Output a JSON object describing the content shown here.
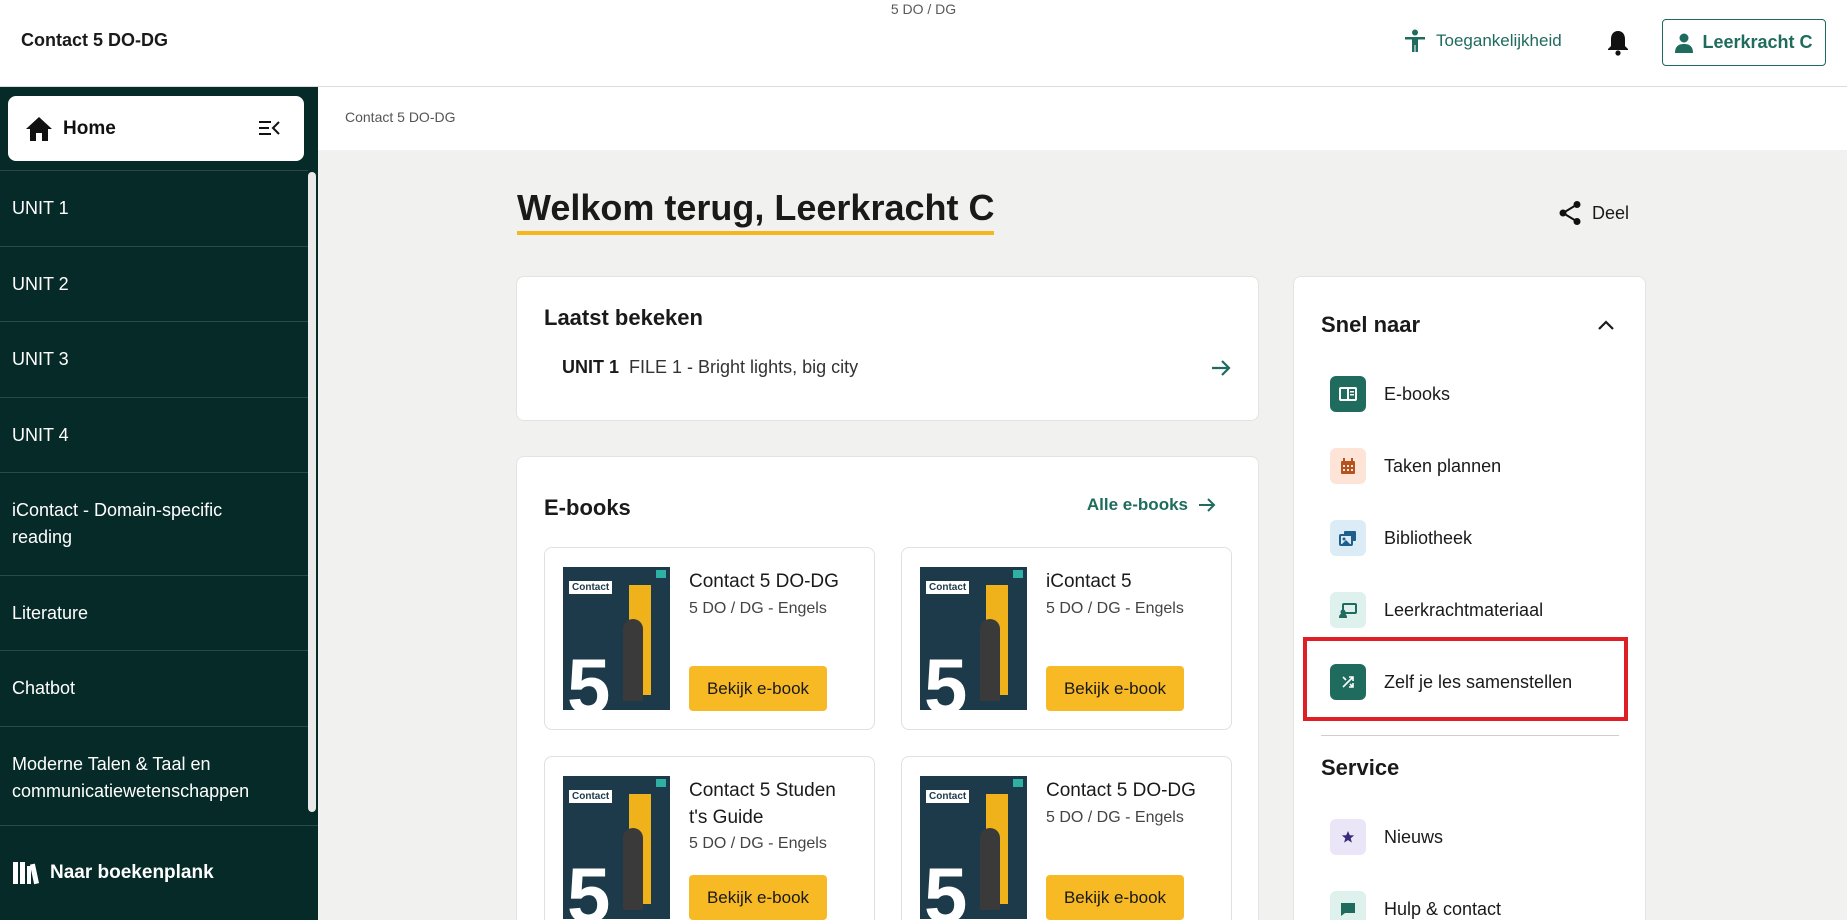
{
  "header": {
    "app_title": "Contact 5 DO-DG",
    "subtitle": "5 DO / DG",
    "accessibility_label": "Toegankelijkheid",
    "user_label": "Leerkracht C"
  },
  "sidebar": {
    "home_label": "Home",
    "items": [
      {
        "label": "UNIT 1"
      },
      {
        "label": "UNIT 2"
      },
      {
        "label": "UNIT 3"
      },
      {
        "label": "UNIT 4"
      },
      {
        "label": "iContact - Domain-specific reading"
      },
      {
        "label": "Literature"
      },
      {
        "label": "Chatbot"
      },
      {
        "label": "Moderne Talen & Taal en communicatiewetenschappen"
      }
    ],
    "shelf_label": "Naar boekenplank"
  },
  "breadcrumb": "Contact 5 DO-DG",
  "main": {
    "welcome": "Welkom terug, Leerkracht C",
    "share_label": "Deel",
    "recent": {
      "title": "Laatst bekeken",
      "unit": "UNIT 1",
      "item": "FILE 1 - Bright lights, big city"
    },
    "ebooks": {
      "title": "E-books",
      "all_label": "Alle e-books",
      "books": [
        {
          "title": "Contact 5 DO-DG",
          "subtitle": "5 DO / DG - Engels",
          "button": "Bekijk e-book",
          "cover_title": "Contact",
          "cover_number": "5"
        },
        {
          "title": "iContact 5",
          "subtitle": "5 DO / DG - Engels",
          "button": "Bekijk e-book",
          "cover_title": "Contact",
          "cover_number": "5"
        },
        {
          "title": "Contact 5 Student's Guide",
          "subtitle": "5 DO / DG - Engels",
          "button": "Bekijk e-book",
          "cover_title": "Contact",
          "cover_number": "5"
        },
        {
          "title": "Contact 5 DO-DG",
          "subtitle": "5 DO / DG - Engels",
          "button": "Bekijk e-book",
          "cover_title": "Contact",
          "cover_number": "5"
        }
      ]
    }
  },
  "quick_links": {
    "title": "Snel naar",
    "items": [
      {
        "label": "E-books",
        "icon": "book-icon",
        "bg": "#1f6b5e",
        "fg": "#ffffff"
      },
      {
        "label": "Taken plannen",
        "icon": "calendar-icon",
        "bg": "#fde4d6",
        "fg": "#b4531f"
      },
      {
        "label": "Bibliotheek",
        "icon": "library-icon",
        "bg": "#dcecf6",
        "fg": "#1f5f8b"
      },
      {
        "label": "Leerkrachtmateriaal",
        "icon": "teacher-board-icon",
        "bg": "#dff1ec",
        "fg": "#1f6b5e"
      },
      {
        "label": "Zelf je les samenstellen",
        "icon": "shuffle-icon",
        "bg": "#1f6b5e",
        "fg": "#ffffff"
      }
    ],
    "service_title": "Service",
    "service_items": [
      {
        "label": "Nieuws",
        "icon": "star-icon",
        "bg": "#ebe6f7",
        "fg": "#3a2a7a"
      },
      {
        "label": "Hulp & contact",
        "icon": "chat-icon",
        "bg": "#dff1ec",
        "fg": "#1f6b5e"
      }
    ]
  },
  "colors": {
    "brand": "#1f6b5e",
    "sidebar": "#062a27",
    "accent": "#f5b71b",
    "highlight": "#e01e26"
  }
}
